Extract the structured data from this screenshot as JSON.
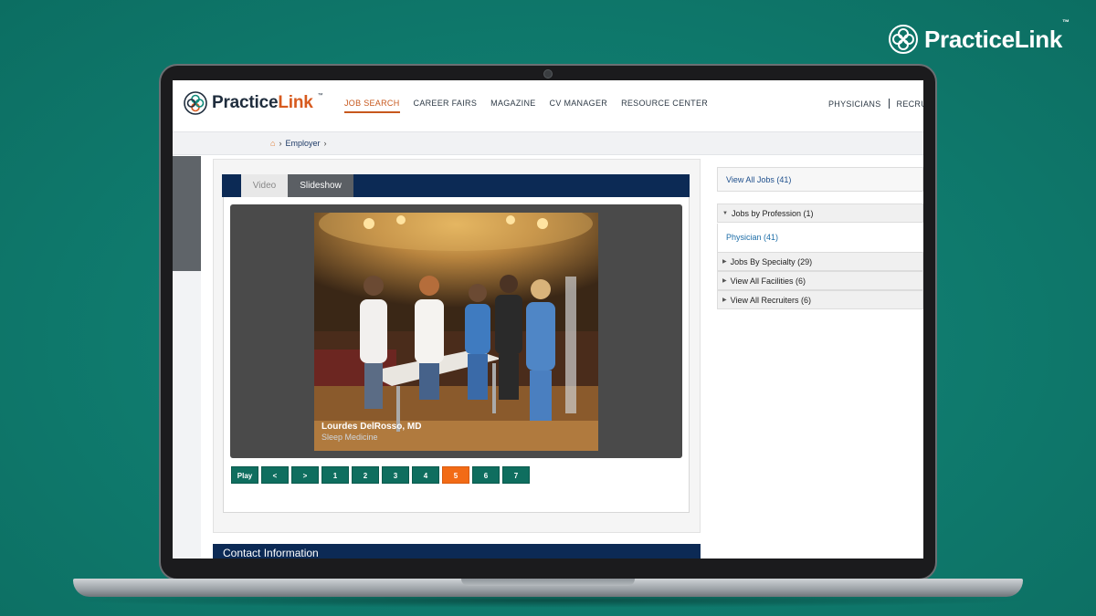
{
  "corner_brand": {
    "name": "PracticeLink",
    "tm": "™"
  },
  "header": {
    "logo_prefix": "Practice",
    "logo_accent": "Link",
    "logo_tm": "™",
    "nav": [
      {
        "label": "JOB SEARCH",
        "active": true
      },
      {
        "label": "CAREER FAIRS",
        "active": false
      },
      {
        "label": "MAGAZINE",
        "active": false
      },
      {
        "label": "CV MANAGER",
        "active": false
      },
      {
        "label": "RESOURCE CENTER",
        "active": false
      }
    ],
    "nav_right": [
      "PHYSICIANS",
      "RECRUITI"
    ]
  },
  "breadcrumb": {
    "items": [
      "Employer"
    ]
  },
  "media": {
    "tabs": [
      {
        "label": "Video",
        "active": false
      },
      {
        "label": "Slideshow",
        "active": true
      }
    ],
    "caption_name": "Lourdes DelRosso, MD",
    "caption_specialty": "Sleep Medicine",
    "pager": [
      {
        "label": "Play",
        "active": false
      },
      {
        "label": "<",
        "active": false
      },
      {
        "label": ">",
        "active": false
      },
      {
        "label": "1",
        "active": false
      },
      {
        "label": "2",
        "active": false
      },
      {
        "label": "3",
        "active": false
      },
      {
        "label": "4",
        "active": false
      },
      {
        "label": "5",
        "active": true
      },
      {
        "label": "6",
        "active": false
      },
      {
        "label": "7",
        "active": false
      }
    ]
  },
  "contact": {
    "title": "Contact Information"
  },
  "sidebar": {
    "view_all_jobs": "View All Jobs (41)",
    "jobs_by_profession": "Jobs by Profession (1)",
    "profession_items": [
      "Physician (41)"
    ],
    "jobs_by_specialty": "Jobs By Specialty (29)",
    "view_all_facilities": "View All Facilities (6)",
    "view_all_recruiters": "View All Recruiters (6)"
  },
  "colors": {
    "background_teal": "#0f7a6d",
    "navy": "#0c2a55",
    "pager_green": "#0f6e5f",
    "pager_active": "#f26b16",
    "accent_orange": "#c7581d"
  }
}
